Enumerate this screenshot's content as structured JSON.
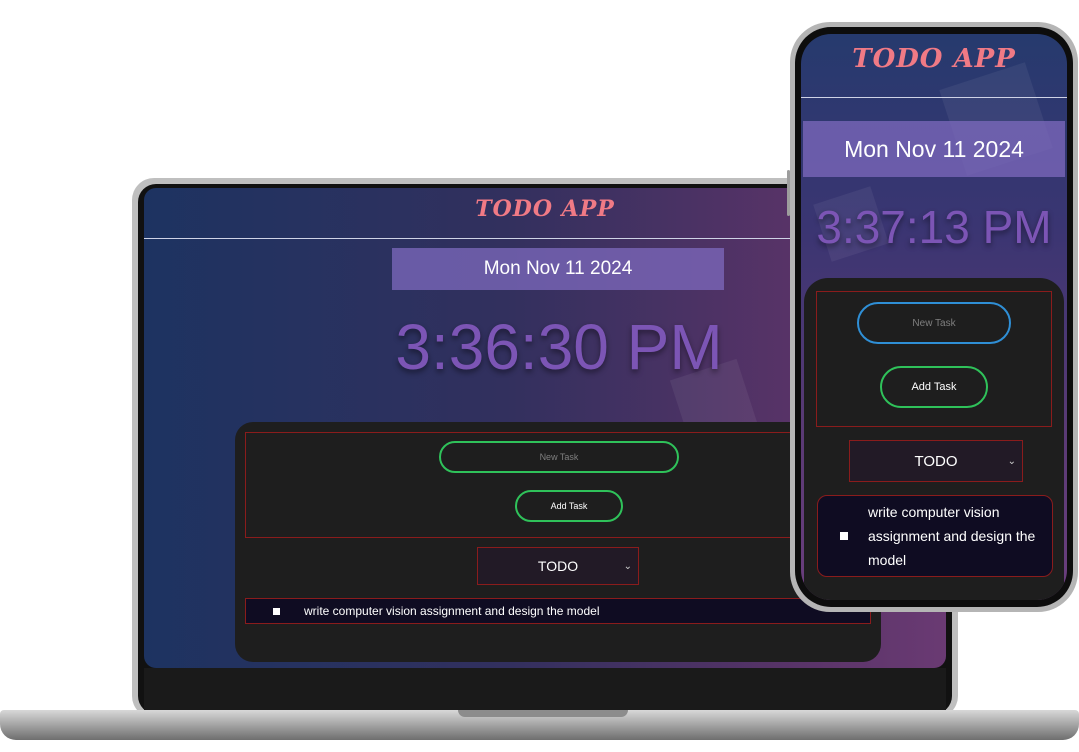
{
  "app": {
    "title": "TODO APP",
    "date": "Mon Nov 11 2024",
    "accent_title": "#f07a85",
    "accent_clock": "#7c55b5",
    "accent_input_border": "#2fc25a",
    "accent_frame_red": "#8a1c1c"
  },
  "laptop": {
    "clock": "3:36:30 PM",
    "input_placeholder": "New Task",
    "add_button": "Add Task",
    "filter_selected": "TODO",
    "filter_icon": "chevron-down-icon",
    "tasks": [
      {
        "text": "write computer vision assignment and design the model"
      }
    ]
  },
  "phone": {
    "clock": "3:37:13 PM",
    "input_placeholder": "New Task",
    "add_button": "Add Task",
    "filter_selected": "TODO",
    "filter_icon": "chevron-down-icon",
    "tasks": [
      {
        "text_line1": "write computer vision",
        "text_line2": "assignment and design the",
        "text_line3": "model"
      }
    ]
  }
}
